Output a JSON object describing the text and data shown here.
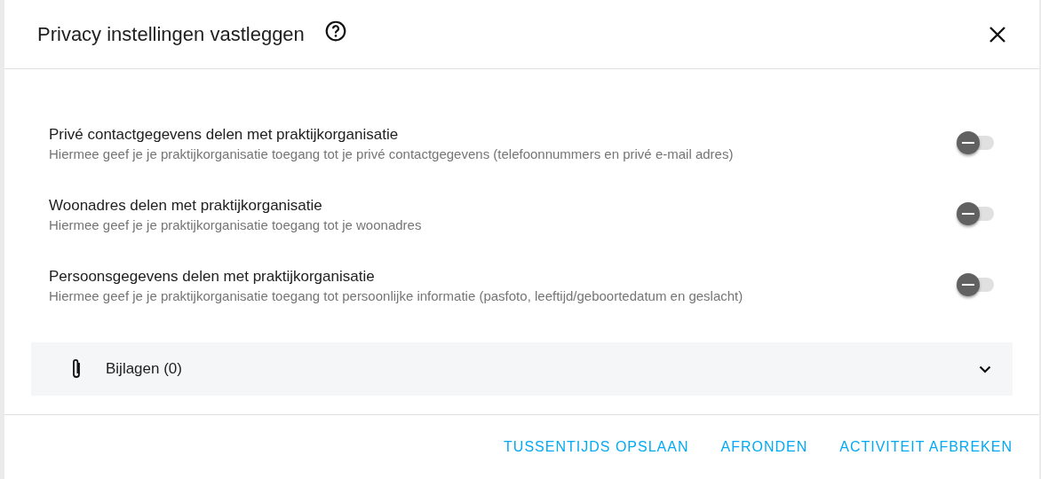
{
  "dialog": {
    "title": "Privacy instellingen vastleggen"
  },
  "settings": [
    {
      "title": "Privé contactgegevens delen met praktijkorganisatie",
      "description": "Hiermee geef je je praktijkorganisatie toegang tot je privé contactgegevens (telefoonnummers en privé e-mail adres)",
      "checked": false,
      "indeterminate": true
    },
    {
      "title": "Woonadres delen met praktijkorganisatie",
      "description": "Hiermee geef je je praktijkorganisatie toegang tot je woonadres",
      "checked": false,
      "indeterminate": true
    },
    {
      "title": "Persoonsgegevens delen met praktijkorganisatie",
      "description": "Hiermee geef je je praktijkorganisatie toegang tot persoonlijke informatie (pasfoto, leeftijd/geboortedatum en geslacht)",
      "checked": false,
      "indeterminate": true
    }
  ],
  "attachments": {
    "label": "Bijlagen (0)",
    "expanded": false
  },
  "buttons": [
    "TUSSENTIJDS OPSLAAN",
    "AFRONDEN",
    "ACTIVITEIT AFBREKEN"
  ]
}
